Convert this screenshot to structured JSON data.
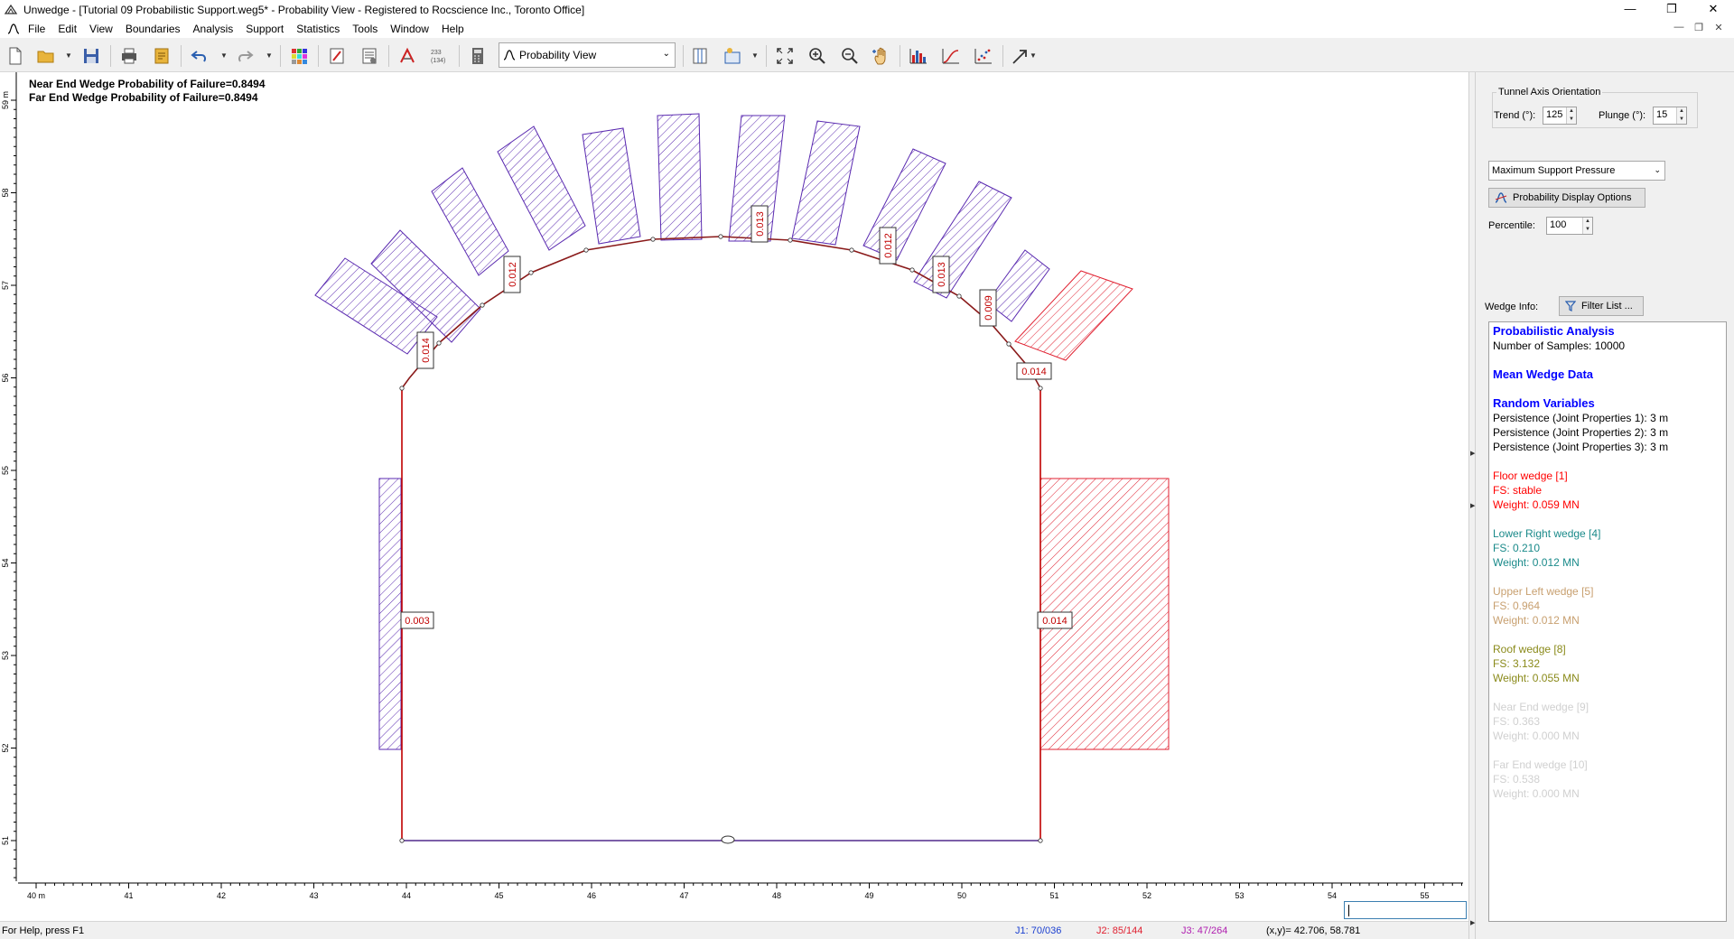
{
  "titlebar": {
    "title": "Unwedge - [Tutorial 09 Probabilistic Support.weg5* - Probability View - Registered to Rocscience Inc., Toronto Office]",
    "minimize": "—",
    "restore": "❐",
    "close": "✕"
  },
  "menu": [
    "File",
    "Edit",
    "View",
    "Boundaries",
    "Analysis",
    "Support",
    "Statistics",
    "Tools",
    "Window",
    "Help"
  ],
  "toolbar": {
    "view_select": "Probability View",
    "icons": [
      "new-file-icon",
      "open-folder-icon",
      "save-icon",
      "print-icon",
      "export-icon",
      "undo-icon",
      "redo-icon",
      "joint-grid-icon",
      "edit-support-icon",
      "support-table-icon",
      "compute-icon",
      "counts-icon",
      "calculator-icon",
      "layout-icon",
      "add-view-icon",
      "zoom-all-icon",
      "zoom-in-icon",
      "zoom-out-icon",
      "pan-icon",
      "histogram-icon",
      "cumulative-icon",
      "scatter-icon",
      "arrow-tool-icon"
    ],
    "counts_label": "(134)"
  },
  "canvas": {
    "near_end_pof": "Near End Wedge Probability of Failure=0.8494",
    "far_end_pof": "Far End Wedge Probability of Failure=0.8494",
    "x_ticks": [
      "40 m",
      "41",
      "42",
      "43",
      "44",
      "45",
      "46",
      "47",
      "48",
      "49",
      "50",
      "51",
      "52",
      "53",
      "54",
      "55"
    ],
    "y_ticks": [
      "51",
      "52",
      "53",
      "54",
      "55",
      "56",
      "57",
      "58",
      "59 m"
    ],
    "pressure_labels": [
      "0.014",
      "0.012",
      "0.013",
      "0.012",
      "0.013",
      "0.009",
      "0.014",
      "0.003",
      "0.014"
    ]
  },
  "panel": {
    "tunnel_axis_title": "Tunnel Axis Orientation",
    "trend_label": "Trend (°):",
    "trend_value": "125",
    "plunge_label": "Plunge (°):",
    "plunge_value": "15",
    "display_select": "Maximum Support Pressure",
    "prob_options_btn": "Probability Display Options",
    "percentile_label": "Percentile:",
    "percentile_value": "100",
    "wedge_info_label": "Wedge Info:",
    "filter_btn": "Filter List ..."
  },
  "wedge_info": [
    {
      "text": "Probabilistic Analysis",
      "color": "#0000ff",
      "bold": true
    },
    {
      "text": "Number of Samples: 10000",
      "color": "#000000"
    },
    {
      "text": "",
      "color": "#000000"
    },
    {
      "text": "Mean Wedge Data",
      "color": "#0000ff",
      "bold": true
    },
    {
      "text": "",
      "color": "#000000"
    },
    {
      "text": "Random Variables",
      "color": "#0000ff",
      "bold": true
    },
    {
      "text": "Persistence (Joint Properties 1): 3 m",
      "color": "#000000"
    },
    {
      "text": "Persistence (Joint Properties 2): 3 m",
      "color": "#000000"
    },
    {
      "text": "Persistence (Joint Properties 3): 3 m",
      "color": "#000000"
    },
    {
      "text": "",
      "color": "#000000"
    },
    {
      "text": "Floor wedge [1]",
      "color": "#ff0000"
    },
    {
      "text": "FS: stable",
      "color": "#ff0000"
    },
    {
      "text": "Weight: 0.059 MN",
      "color": "#ff0000"
    },
    {
      "text": "",
      "color": "#000000"
    },
    {
      "text": "Lower Right wedge [4]",
      "color": "#1a8a8a"
    },
    {
      "text": "FS: 0.210",
      "color": "#1a8a8a"
    },
    {
      "text": "Weight: 0.012 MN",
      "color": "#1a8a8a"
    },
    {
      "text": "",
      "color": "#000000"
    },
    {
      "text": "Upper Left wedge [5]",
      "color": "#c8a070"
    },
    {
      "text": "FS: 0.964",
      "color": "#c8a070"
    },
    {
      "text": "Weight: 0.012 MN",
      "color": "#c8a070"
    },
    {
      "text": "",
      "color": "#000000"
    },
    {
      "text": "Roof wedge [8]",
      "color": "#8a8a1a"
    },
    {
      "text": "FS: 3.132",
      "color": "#8a8a1a"
    },
    {
      "text": "Weight: 0.055 MN",
      "color": "#8a8a1a"
    },
    {
      "text": "",
      "color": "#000000"
    },
    {
      "text": "Near End wedge [9]",
      "color": "#d0d0d0"
    },
    {
      "text": "FS: 0.363",
      "color": "#d0d0d0"
    },
    {
      "text": "Weight: 0.000 MN",
      "color": "#d0d0d0"
    },
    {
      "text": "",
      "color": "#000000"
    },
    {
      "text": "Far End wedge [10]",
      "color": "#d0d0d0"
    },
    {
      "text": "FS: 0.538",
      "color": "#d0d0d0"
    },
    {
      "text": "Weight: 0.000 MN",
      "color": "#d0d0d0"
    }
  ],
  "status": {
    "help": "For Help, press F1",
    "j1": "J1: 70/036",
    "j2": "J2: 85/144",
    "j3": "J3: 47/264",
    "xy": "(x,y)= 42.706, 58.781"
  },
  "colors": {
    "accent_blue": "#0000ff",
    "tunnel_red": "#c00000",
    "hatch_purple": "#5a2ab0",
    "hatch_red": "#e02030",
    "j1": "#1a3fd0",
    "j2": "#e02030",
    "j3": "#b020b0"
  }
}
